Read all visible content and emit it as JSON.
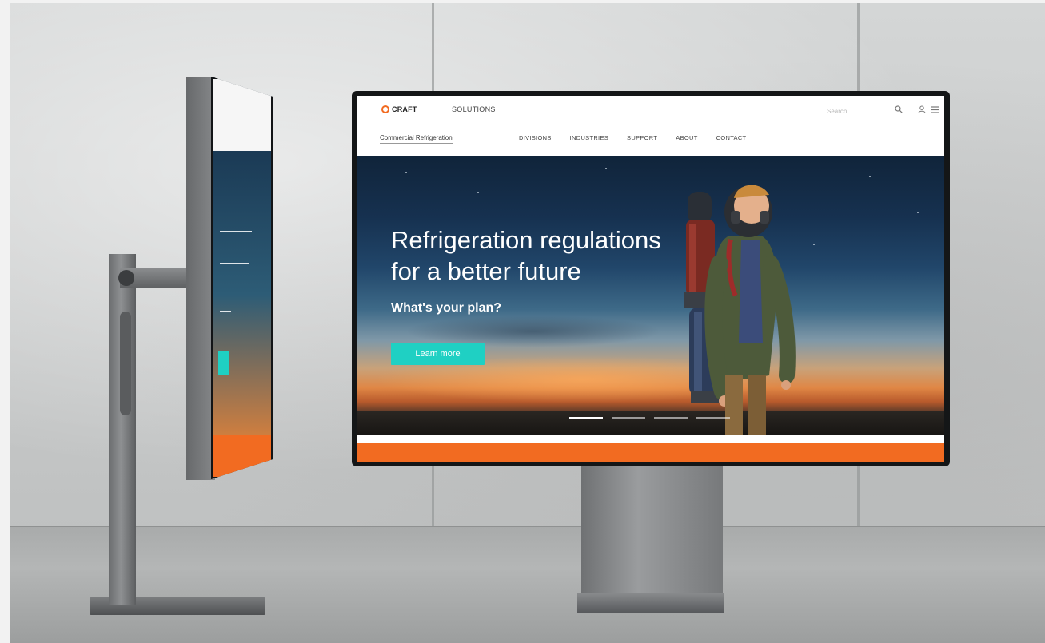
{
  "site": {
    "logo_text": "CRAFT",
    "solutions_label": "SOLUTIONS",
    "search_placeholder": "Search",
    "icons": [
      "search-icon",
      "user-icon",
      "menu-icon"
    ],
    "division_label": "Commercial Refrigeration",
    "nav": [
      "DIVISIONS",
      "INDUSTRIES",
      "SUPPORT",
      "ABOUT",
      "CONTACT"
    ]
  },
  "hero": {
    "title": "Refrigeration regulations for a better future",
    "subtitle": "What's your plan?",
    "cta_label": "Learn more",
    "slides_count": 4,
    "active_slide": 1
  },
  "colors": {
    "accent_orange": "#f26b21",
    "cta_teal": "#1fd0c3"
  }
}
